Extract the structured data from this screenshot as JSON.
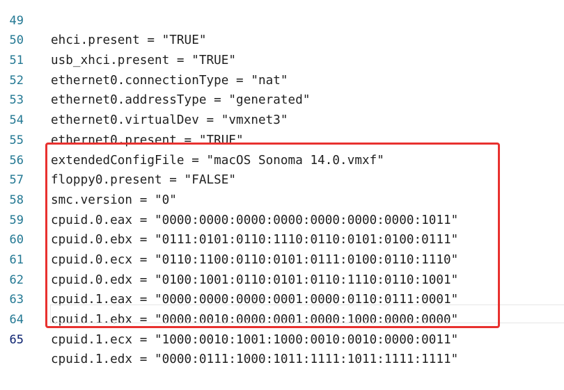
{
  "editor": {
    "lines": [
      {
        "number": "49",
        "text": "ehci.present = \"TRUE\""
      },
      {
        "number": "50",
        "text": "usb_xhci.present = \"TRUE\""
      },
      {
        "number": "51",
        "text": "ethernet0.connectionType = \"nat\""
      },
      {
        "number": "52",
        "text": "ethernet0.addressType = \"generated\""
      },
      {
        "number": "53",
        "text": "ethernet0.virtualDev = \"vmxnet3\""
      },
      {
        "number": "54",
        "text": "ethernet0.present = \"TRUE\""
      },
      {
        "number": "55",
        "text": "extendedConfigFile = \"macOS Sonoma 14.0.vmxf\""
      },
      {
        "number": "56",
        "text": "floppy0.present = \"FALSE\""
      },
      {
        "number": "57",
        "text": "smc.version = \"0\""
      },
      {
        "number": "58",
        "text": "cpuid.0.eax = \"0000:0000:0000:0000:0000:0000:0000:1011\""
      },
      {
        "number": "59",
        "text": "cpuid.0.ebx = \"0111:0101:0110:1110:0110:0101:0100:0111\""
      },
      {
        "number": "60",
        "text": "cpuid.0.ecx = \"0110:1100:0110:0101:0111:0100:0110:1110\""
      },
      {
        "number": "61",
        "text": "cpuid.0.edx = \"0100:1001:0110:0101:0110:1110:0110:1001\""
      },
      {
        "number": "62",
        "text": "cpuid.1.eax = \"0000:0000:0000:0001:0000:0110:0111:0001\""
      },
      {
        "number": "63",
        "text": "cpuid.1.ebx = \"0000:0010:0000:0001:0000:1000:0000:0000\""
      },
      {
        "number": "64",
        "text": "cpuid.1.ecx = \"1000:0010:1001:1000:0010:0010:0000:0011\""
      },
      {
        "number": "65",
        "text": "cpuid.1.edx = \"0000:0111:1000:1011:1111:1011:1111:1111\""
      }
    ],
    "current_line": "65"
  },
  "colors": {
    "line_number": "#237893",
    "current_line_number": "#0b216f",
    "code_text": "#1f1f1f",
    "highlight_border": "#e8312f",
    "background": "#ffffff"
  }
}
